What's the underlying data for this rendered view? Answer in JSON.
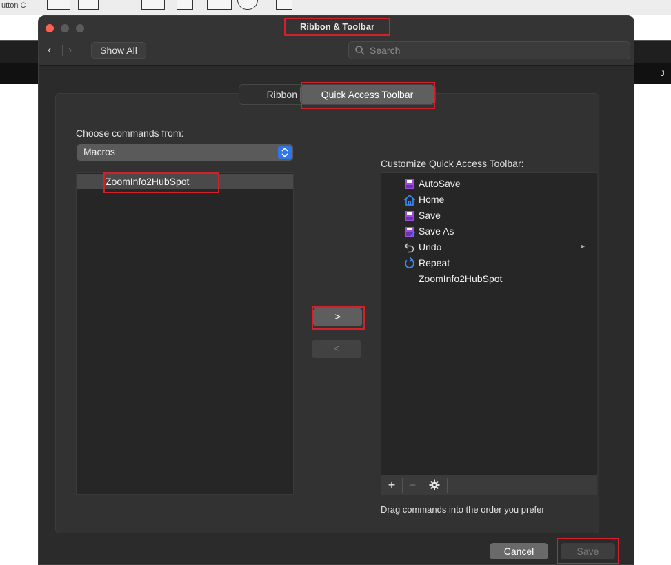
{
  "background_app": {
    "toolbar_label": "utton C",
    "column_j": "J"
  },
  "window": {
    "title": "Ribbon & Toolbar",
    "nav": {
      "show_all_label": "Show All"
    },
    "search": {
      "placeholder": "Search"
    }
  },
  "tabs": [
    {
      "label": "Ribbon",
      "selected": false
    },
    {
      "label": "Quick Access Toolbar",
      "selected": true
    }
  ],
  "left_pane": {
    "label": "Choose commands from:",
    "dropdown_value": "Macros",
    "items": [
      {
        "label": "ZoomInfo2HubSpot",
        "selected": true
      }
    ]
  },
  "transfer": {
    "add_label": ">",
    "remove_label": "<"
  },
  "right_pane": {
    "label": "Customize Quick Access Toolbar:",
    "items": [
      {
        "label": "AutoSave",
        "icon": "autosave-icon"
      },
      {
        "label": "Home",
        "icon": "home-icon"
      },
      {
        "label": "Save",
        "icon": "save-icon"
      },
      {
        "label": "Save As",
        "icon": "save-as-icon"
      },
      {
        "label": "Undo",
        "icon": "undo-icon"
      },
      {
        "label": "Repeat",
        "icon": "repeat-icon"
      },
      {
        "label": "ZoomInfo2HubSpot",
        "icon": ""
      }
    ],
    "toolbar": {
      "add": "+",
      "remove": "−",
      "settings_icon": "gear-icon"
    },
    "hint": "Drag commands into the order you prefer"
  },
  "footer": {
    "cancel_label": "Cancel",
    "save_label": "Save"
  },
  "colors": {
    "highlight": "#d3202a",
    "accent": "#2f76e6",
    "icon_purple": "#9b4fd6",
    "icon_blue": "#3f88f5"
  }
}
